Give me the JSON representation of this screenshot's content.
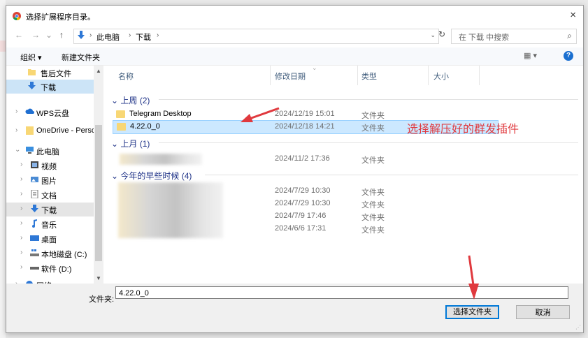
{
  "dialog": {
    "title": "选择扩展程序目录。",
    "close": "×"
  },
  "navbar": {
    "back": "←",
    "forward": "→",
    "up": "↑",
    "crumbs": [
      "此电脑",
      "下载"
    ],
    "crumb_sep": "›",
    "dropdown": "⌄",
    "refresh": "↻",
    "search_placeholder": "在 下载 中搜索",
    "search_icon": "⌕"
  },
  "toolbar": {
    "organize": "组织 ▾",
    "new_folder": "新建文件夹",
    "view": "▦ ▾",
    "help": "?"
  },
  "nav": {
    "items": [
      {
        "label": "售后文件",
        "icon": "folder-icon"
      },
      {
        "label": "下载",
        "icon": "download-icon"
      },
      {
        "label": "WPS云盘",
        "icon": "cloud-icon"
      },
      {
        "label": "OneDrive - Perso",
        "icon": "folder-icon"
      },
      {
        "label": "此电脑",
        "icon": "computer-icon"
      },
      {
        "label": "视频",
        "icon": "video-icon"
      },
      {
        "label": "图片",
        "icon": "picture-icon"
      },
      {
        "label": "文档",
        "icon": "document-icon"
      },
      {
        "label": "下载",
        "icon": "download-icon"
      },
      {
        "label": "音乐",
        "icon": "music-icon"
      },
      {
        "label": "桌面",
        "icon": "desktop-icon"
      },
      {
        "label": "本地磁盘 (C:)",
        "icon": "drive-icon"
      },
      {
        "label": "软件 (D:)",
        "icon": "drive-icon"
      },
      {
        "label": "网络",
        "icon": "network-icon"
      }
    ]
  },
  "columns": {
    "name": "名称",
    "modified": "修改日期",
    "type": "类型",
    "size": "大小",
    "sort_indicator": "⌄"
  },
  "groups": [
    {
      "label": "上周 (2)"
    },
    {
      "label": "上月 (1)"
    },
    {
      "label": "今年的早些时候 (4)"
    }
  ],
  "files": {
    "telegram": {
      "name": "Telegram Desktop",
      "date": "2024/12/19 15:01",
      "type": "文件夹"
    },
    "selected": {
      "name": "4.22.0_0",
      "date": "2024/12/18 14:21",
      "type": "文件夹"
    },
    "last_month": [
      {
        "date": "2024/11/2 17:36",
        "type": "文件夹"
      }
    ],
    "earlier": [
      {
        "date": "2024/7/29 10:30",
        "type": "文件夹"
      },
      {
        "date": "2024/7/29 10:30",
        "type": "文件夹"
      },
      {
        "date": "2024/7/9 17:46",
        "type": "文件夹"
      },
      {
        "date": "2024/6/6 17:31",
        "type": "文件夹"
      }
    ]
  },
  "annotation": "选择解压好的群发插件",
  "bottom": {
    "folder_label": "文件夹:",
    "folder_value": "4.22.0_0",
    "select_button": "选择文件夹",
    "cancel_button": "取消"
  },
  "colors": {
    "accent": "#0078d7",
    "selection": "#cce8ff",
    "annotation_red": "#e0393e",
    "group_header": "#1e3287"
  },
  "background_fragment": "层"
}
